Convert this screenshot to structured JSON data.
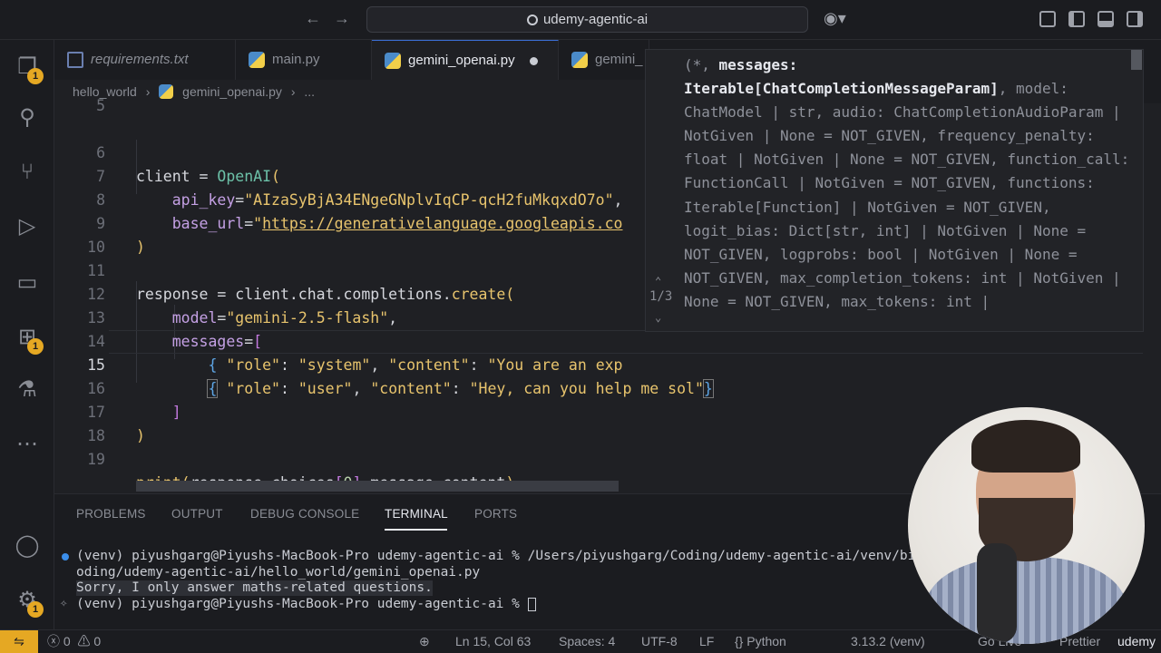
{
  "titlebar": {
    "search_text": "udemy-agentic-ai"
  },
  "activity_badges": {
    "explorer": "1",
    "extensions": "1",
    "manage": "1"
  },
  "tabs": [
    {
      "label": "requirements.txt",
      "kind": "text"
    },
    {
      "label": "main.py",
      "kind": "python"
    },
    {
      "label": "gemini_openai.py",
      "kind": "python",
      "active": true,
      "modified": true
    },
    {
      "label": "gemini_",
      "kind": "python"
    }
  ],
  "breadcrumb": {
    "folder": "hello_world",
    "file": "gemini_openai.py",
    "more": "..."
  },
  "editor": {
    "lines": [
      {
        "n": "5",
        "text": ""
      },
      {
        "n": "6",
        "text": "client = OpenAI("
      },
      {
        "n": "7",
        "text": "    api_key=\"AIzaSyBjA34ENgeGNplvIqCP-qcH2fuMkqxdO7o\","
      },
      {
        "n": "8",
        "text": "    base_url=\"https://generativelanguage.googleapis.co"
      },
      {
        "n": "9",
        "text": ")"
      },
      {
        "n": "10",
        "text": ""
      },
      {
        "n": "11",
        "text": "response = client.chat.completions.create("
      },
      {
        "n": "12",
        "text": "    model=\"gemini-2.5-flash\","
      },
      {
        "n": "13",
        "text": "    messages=["
      },
      {
        "n": "14",
        "text": "        { \"role\": \"system\", \"content\": \"You are an exp"
      },
      {
        "n": "15",
        "text": "        { \"role\": \"user\", \"content\": \"Hey, can you help me sol\"}"
      },
      {
        "n": "16",
        "text": "    ]"
      },
      {
        "n": "17",
        "text": ")"
      },
      {
        "n": "18",
        "text": ""
      },
      {
        "n": "19",
        "text": "print(response.choices[0].message.content)"
      }
    ]
  },
  "signature_help": {
    "counter": "1/3",
    "prefix": "(*, ",
    "param_name": "messages:",
    "param_type": "Iterable[ChatCompletionMessageParam]",
    "rest": ", model: ChatModel | str, audio: ChatCompletionAudioParam | NotGiven | None = NOT_GIVEN, frequency_penalty: float | NotGiven | None = NOT_GIVEN, function_call: FunctionCall | NotGiven = NOT_GIVEN, functions: Iterable[Function] | NotGiven = NOT_GIVEN, logit_bias: Dict[str, int] | NotGiven | None = NOT_GIVEN, logprobs: bool | NotGiven | None = NOT_GIVEN, max_completion_tokens: int | NotGiven | None = NOT_GIVEN, max_tokens: int |"
  },
  "panel": {
    "tabs": [
      "PROBLEMS",
      "OUTPUT",
      "DEBUG CONSOLE",
      "TERMINAL",
      "PORTS"
    ],
    "active_tab": "TERMINAL",
    "terminal_lines": [
      "(venv) piyushgarg@Piyushs-MacBook-Pro udemy-agentic-ai % /Users/piyushgarg/Coding/udemy-agentic-ai/venv/bi",
      "oding/udemy-agentic-ai/hello_world/gemini_openai.py",
      "Sorry, I only answer maths-related questions.",
      "(venv) piyushgarg@Piyushs-MacBook-Pro udemy-agentic-ai % "
    ]
  },
  "statusbar": {
    "errors": "0",
    "warnings": "0",
    "position": "Ln 15, Col 63",
    "spaces": "Spaces: 4",
    "encoding": "UTF-8",
    "eol": "LF",
    "language": "Python",
    "interpreter": "3.13.2 (venv)",
    "golive": "Go Live",
    "prettier": "Prettier"
  },
  "watermark": "udemy"
}
